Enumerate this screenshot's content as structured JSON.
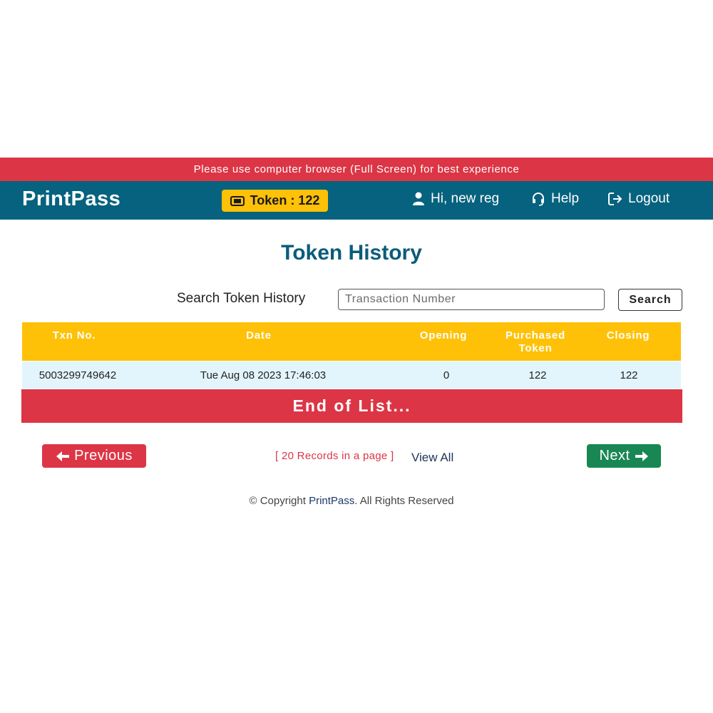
{
  "banner": {
    "text": "Please use computer browser (Full Screen) for best experience"
  },
  "navbar": {
    "brand": "PrintPass",
    "token_label": "Token : 122",
    "user_label": "Hi, new reg",
    "help_label": "Help",
    "logout_label": "Logout",
    "colors": {
      "navbar_bg": "#06627e",
      "banner_bg": "#dc3545",
      "token_bg": "#ffc107"
    },
    "icons": [
      "ticket-icon",
      "user-icon",
      "headset-icon",
      "logout-icon"
    ]
  },
  "main": {
    "title": "Token History",
    "search": {
      "label": "Search Token History",
      "placeholder": "Transaction Number",
      "value": "",
      "button_label": "Search"
    },
    "table": {
      "headers": [
        "Txn No.",
        "Date",
        "Opening",
        "Purchased Token",
        "Closing"
      ],
      "headers_lines": {
        "purchased_line1": "Purchased",
        "purchased_line2": "Token"
      },
      "rows": [
        {
          "txn_no": "5003299749642",
          "date": "Tue Aug 08 2023 17:46:03",
          "opening": "0",
          "purchased": "122",
          "closing": "122"
        }
      ],
      "end_of_list": "End of List..."
    }
  },
  "pagination": {
    "previous_label": "Previous",
    "next_label": "Next",
    "records_info": "[ 20 Records in a page ]",
    "view_all_label": "View All",
    "colors": {
      "previous_bg": "#dc3545",
      "next_bg": "#198754"
    }
  },
  "footer": {
    "prefix": "© Copyright ",
    "brand": "PrintPass",
    "suffix": ". All Rights Reserved"
  }
}
